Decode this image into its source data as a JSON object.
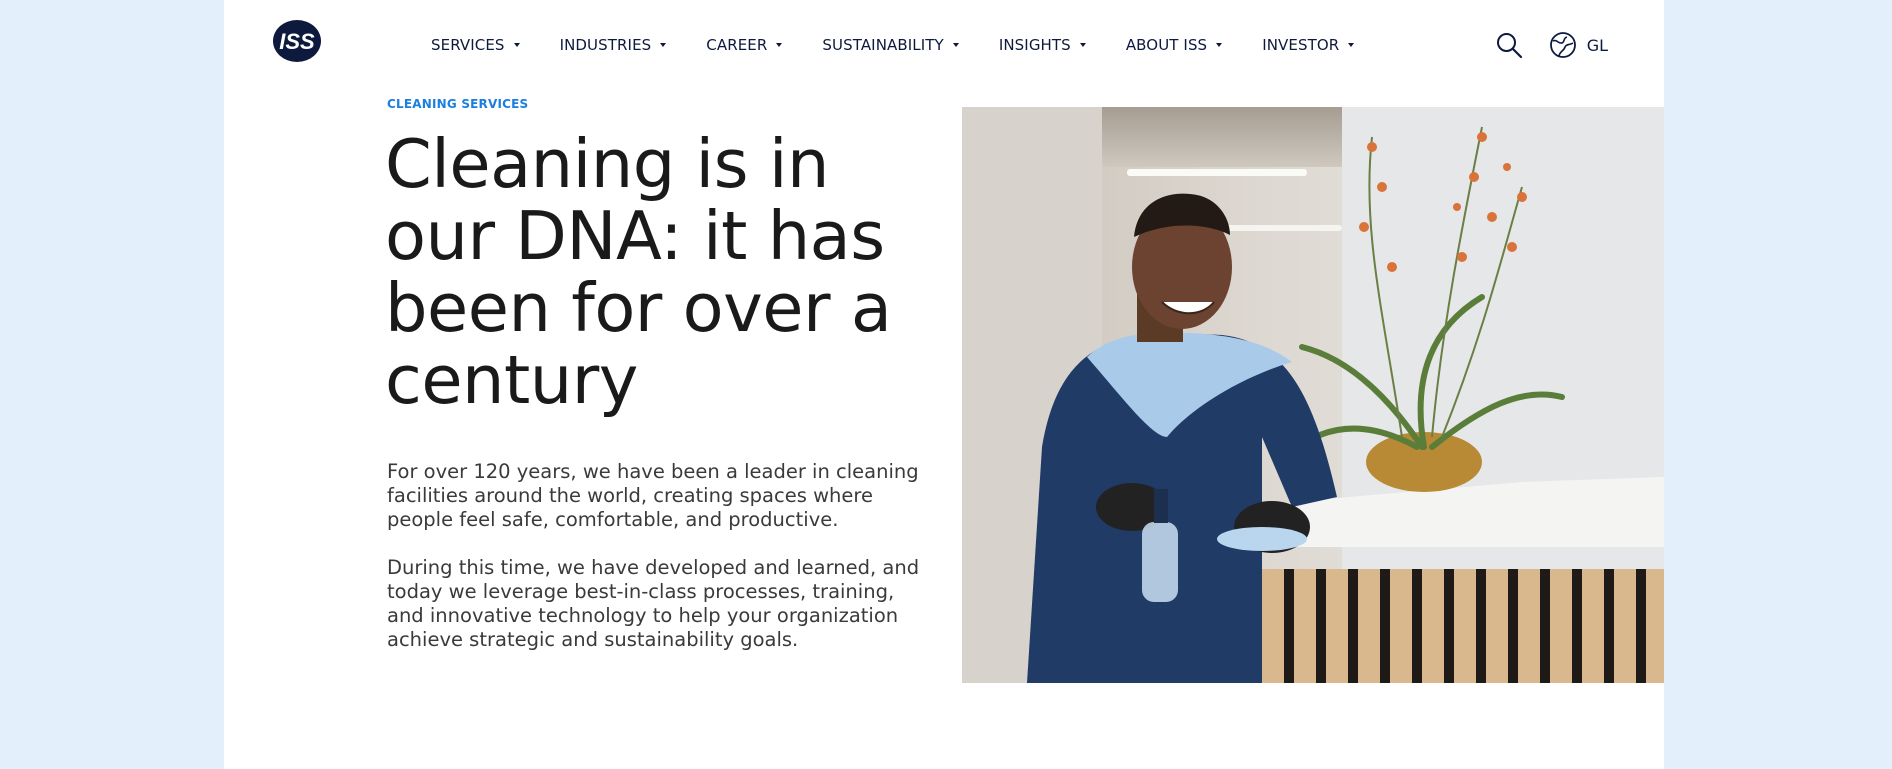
{
  "brand": {
    "logo_text": "ISS"
  },
  "nav": {
    "items": [
      {
        "label": "SERVICES"
      },
      {
        "label": "INDUSTRIES"
      },
      {
        "label": "CAREER"
      },
      {
        "label": "SUSTAINABILITY"
      },
      {
        "label": "INSIGHTS"
      },
      {
        "label": "ABOUT ISS"
      },
      {
        "label": "INVESTOR"
      }
    ]
  },
  "header_tools": {
    "language_code": "GL",
    "search_icon": "search-icon",
    "globe_icon": "globe-icon"
  },
  "hero": {
    "eyebrow": "CLEANING SERVICES",
    "title": "Cleaning is in our DNA: it has been for over a century",
    "paragraph_1": "For over 120 years, we have been a leader in cleaning facilities around the world, creating spaces where people feel safe, comfortable, and productive.",
    "paragraph_2": "During this time, we have developed and learned, and today we leverage best-in-class processes, training, and innovative technology to help your organization achieve strategic and sustainability goals."
  },
  "colors": {
    "accent": "#1b7fe0",
    "navy": "#0e1a3d",
    "background": "#e3f0fc"
  }
}
